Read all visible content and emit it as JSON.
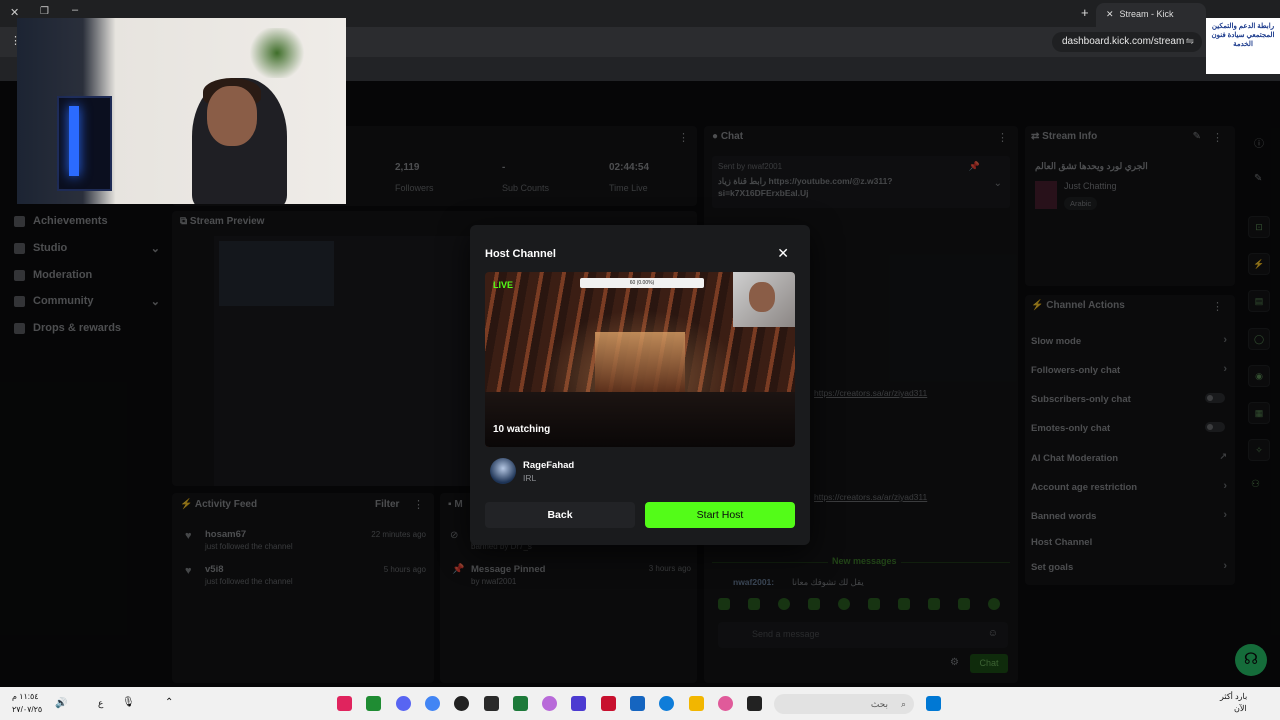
{
  "browser": {
    "tab_title": "Stream - Kick Dashboard",
    "url": "dashboard.kick.com/stream"
  },
  "sidebar": {
    "items": [
      {
        "label": "Achievements",
        "icon": "trophy-icon"
      },
      {
        "label": "Studio",
        "icon": "studio-icon"
      },
      {
        "label": "Moderation",
        "icon": "wrench-icon"
      },
      {
        "label": "Community",
        "icon": "community-icon"
      },
      {
        "label": "Drops & rewards",
        "icon": "gift-icon"
      }
    ]
  },
  "stats": {
    "followers_value": "2,119",
    "followers_label": "Followers",
    "subs_value": "-",
    "subs_label": "Sub Counts",
    "time_value": "02:44:54",
    "time_label": "Time Live"
  },
  "stream_preview": {
    "title": "Stream Preview"
  },
  "activity": {
    "title": "Activity Feed",
    "filter": "Filter",
    "items": [
      {
        "user": "hosam67",
        "text": "just followed the channel",
        "time": "22 minutes ago"
      },
      {
        "user": "v5i8",
        "text": "just followed the channel",
        "time": "5 hours ago"
      }
    ]
  },
  "mod_log": {
    "title": "M",
    "pinned_title": "Message Pinned",
    "pinned_by": "by nwaf2001",
    "pinned_time": "3 hours ago",
    "banned_by": "banned by Dr7_s"
  },
  "chat": {
    "title": "Chat",
    "pinned_sender": "Sent by nwaf2001",
    "pinned_text": "رابط قناة زياد https://youtube.com/@z.w311?si=k7X16DFErxbEal.Uj",
    "link1": "https://creators.sa/ar/ziyad311",
    "link2": "https://creators.sa/ar/ziyad311",
    "new_messages": "New messages",
    "last_message_user": "nwaf2001:",
    "last_message_text": "يقل لك تشوفك معانا",
    "input_placeholder": "Send a message",
    "send_label": "Chat"
  },
  "stream_info": {
    "title": "Stream Info",
    "stream_title": "الجري لورد ويحدها تشق العالم",
    "category": "Just Chatting",
    "language": "Arabic"
  },
  "channel_actions": {
    "title": "Channel Actions",
    "items": [
      {
        "label": "Slow mode",
        "control": "chevron"
      },
      {
        "label": "Followers-only chat",
        "control": "chevron"
      },
      {
        "label": "Subscribers-only chat",
        "control": "toggle"
      },
      {
        "label": "Emotes-only chat",
        "control": "toggle"
      },
      {
        "label": "AI Chat Moderation",
        "control": "external"
      },
      {
        "label": "Account age restriction",
        "control": "chevron"
      },
      {
        "label": "Banned words",
        "control": "chevron"
      },
      {
        "label": "Host Channel",
        "control": "none"
      },
      {
        "label": "Set goals",
        "control": "chevron"
      }
    ]
  },
  "modal": {
    "title": "Host Channel",
    "live_badge": "LIVE",
    "watching": "10 watching",
    "channel_name": "RageFahad",
    "channel_category": "IRL",
    "back_label": "Back",
    "start_label": "Start Host",
    "preview_topbar": "60 (0.00%)"
  },
  "logo_text": "رابطة الدعم والتمكين المجتمعي سيادة فنون الخدمة",
  "taskbar": {
    "search_placeholder": "بحث",
    "weather": "بارد أكثر",
    "weather_sub": "الآن",
    "time": "١١:٥٤ م",
    "date": "٢٧/٠٧/٢٥",
    "lang": "ع"
  },
  "colors": {
    "accent": "#53fc18",
    "background": "#0b0c0d",
    "panel": "#141517"
  }
}
